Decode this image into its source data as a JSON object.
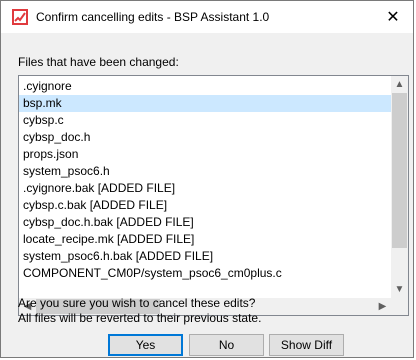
{
  "window": {
    "title": "Confirm cancelling edits - BSP Assistant 1.0",
    "close_glyph": "✕"
  },
  "files_label": "Files that have been changed:",
  "files": [
    {
      "name": ".cyignore",
      "selected": false
    },
    {
      "name": "bsp.mk",
      "selected": true
    },
    {
      "name": "cybsp.c",
      "selected": false
    },
    {
      "name": "cybsp_doc.h",
      "selected": false
    },
    {
      "name": "props.json",
      "selected": false
    },
    {
      "name": "system_psoc6.h",
      "selected": false
    },
    {
      "name": ".cyignore.bak [ADDED FILE]",
      "selected": false
    },
    {
      "name": "cybsp.c.bak [ADDED FILE]",
      "selected": false
    },
    {
      "name": "cybsp_doc.h.bak [ADDED FILE]",
      "selected": false
    },
    {
      "name": "locate_recipe.mk [ADDED FILE]",
      "selected": false
    },
    {
      "name": "system_psoc6.h.bak [ADDED FILE]",
      "selected": false
    },
    {
      "name": "COMPONENT_CM0P/system_psoc6_cm0plus.c",
      "selected": false
    }
  ],
  "scrollbar": {
    "up_glyph": "▲",
    "down_glyph": "▼",
    "left_glyph": "◀",
    "right_glyph": "▶"
  },
  "message": {
    "line1": "Are you sure you wish to cancel these edits?",
    "line2": "All files will be reverted to their previous state."
  },
  "buttons": {
    "yes": "Yes",
    "no": "No",
    "show_diff": "Show Diff"
  },
  "colors": {
    "selection": "#cce8ff",
    "default_button_border": "#0078d7",
    "icon_red": "#e03a3e"
  }
}
